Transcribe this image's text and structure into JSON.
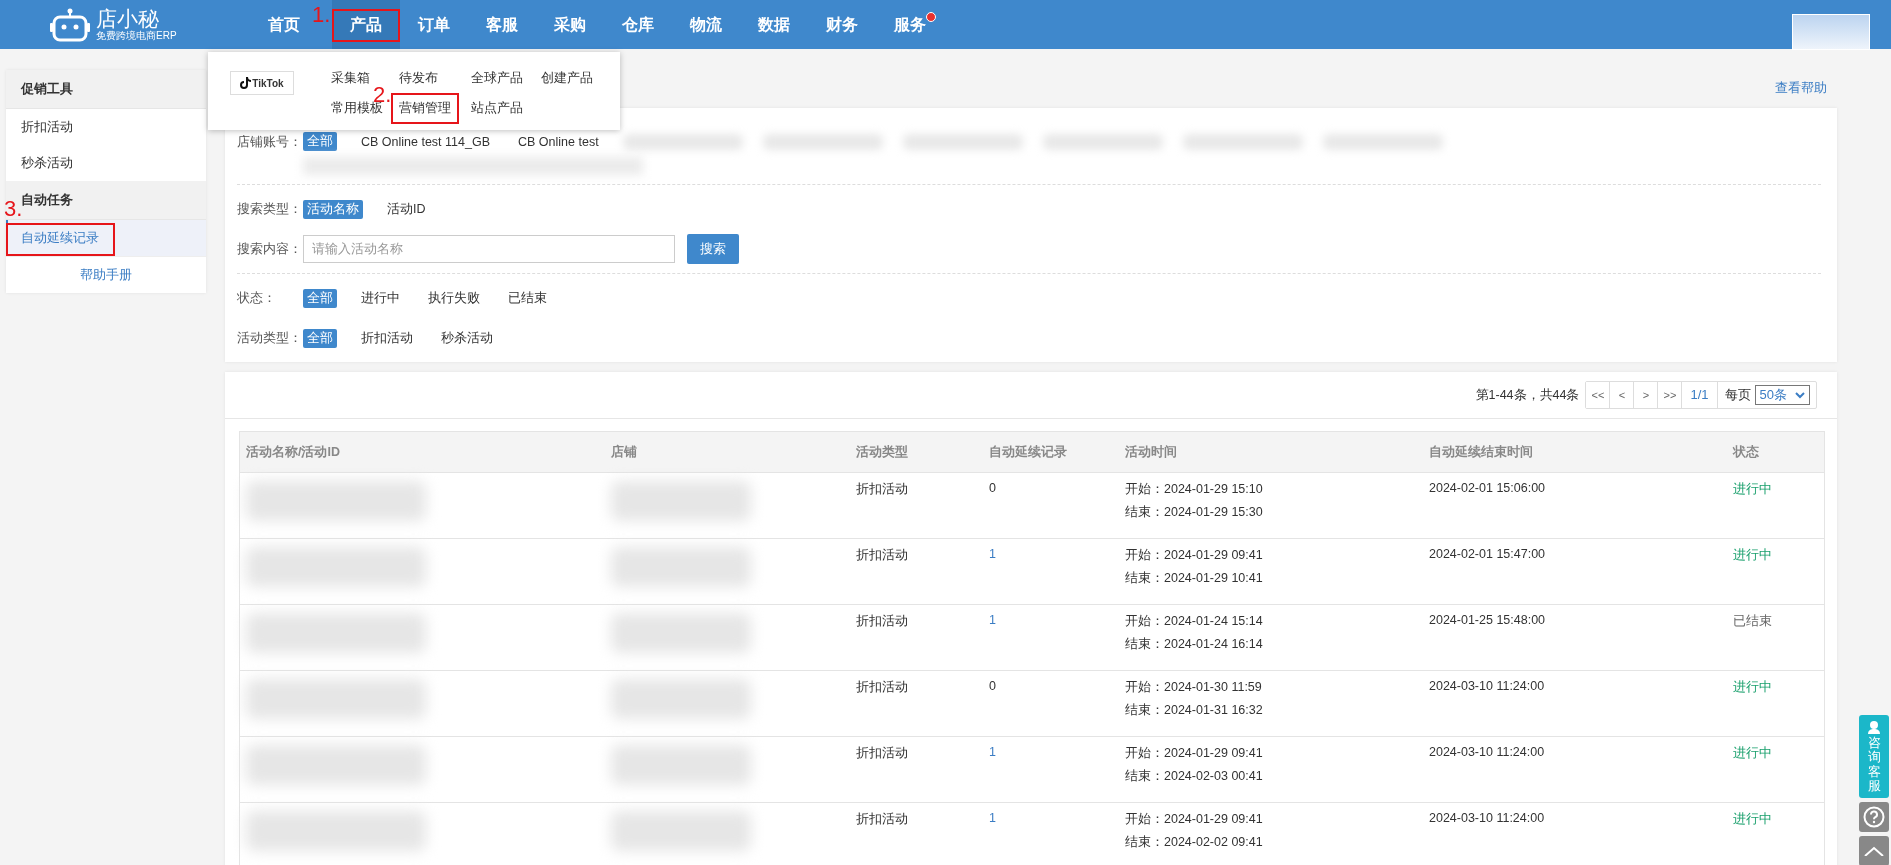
{
  "header": {
    "logo": {
      "name": "店小秘",
      "tagline": "免费跨境电商ERP"
    },
    "nav": [
      {
        "label": "首页",
        "selected": false,
        "dot": false
      },
      {
        "label": "产品",
        "selected": true,
        "dot": false,
        "annotation": "1."
      },
      {
        "label": "订单",
        "selected": false,
        "dot": false
      },
      {
        "label": "客服",
        "selected": false,
        "dot": false
      },
      {
        "label": "采购",
        "selected": false,
        "dot": false
      },
      {
        "label": "仓库",
        "selected": false,
        "dot": false
      },
      {
        "label": "物流",
        "selected": false,
        "dot": false
      },
      {
        "label": "数据",
        "selected": false,
        "dot": false
      },
      {
        "label": "财务",
        "selected": false,
        "dot": false
      },
      {
        "label": "服务",
        "selected": false,
        "dot": true
      }
    ]
  },
  "dropdown": {
    "platform": "TikTok",
    "items": [
      {
        "label": "采集箱"
      },
      {
        "label": "待发布"
      },
      {
        "label": "全球产品"
      },
      {
        "label": "创建产品"
      },
      {
        "label": "常用模板"
      },
      {
        "label": "营销管理",
        "annotation": "2."
      },
      {
        "label": "站点产品"
      }
    ]
  },
  "sidebar": {
    "groups": [
      {
        "title": "促销工具",
        "items": [
          {
            "label": "折扣活动",
            "selected": false
          },
          {
            "label": "秒杀活动",
            "selected": false
          }
        ]
      },
      {
        "title": "自动任务",
        "items": [
          {
            "label": "自动延续记录",
            "selected": true,
            "annotation": "3."
          }
        ]
      }
    ],
    "help": "帮助手册"
  },
  "help_link": "查看帮助",
  "filters": {
    "shop": {
      "label": "店铺账号：",
      "options": [
        {
          "label": "全部",
          "selected": true
        },
        {
          "label": "CB Online test 114_GB",
          "selected": false
        },
        {
          "label": "CB Online test",
          "selected": false
        }
      ]
    },
    "search_type": {
      "label": "搜索类型：",
      "options": [
        {
          "label": "活动名称",
          "selected": true
        },
        {
          "label": "活动ID",
          "selected": false
        }
      ]
    },
    "search": {
      "label": "搜索内容：",
      "placeholder": "请输入活动名称",
      "button": "搜索"
    },
    "status": {
      "label": "状态：",
      "options": [
        {
          "label": "全部",
          "selected": true
        },
        {
          "label": "进行中",
          "selected": false
        },
        {
          "label": "执行失败",
          "selected": false
        },
        {
          "label": "已结束",
          "selected": false
        }
      ]
    },
    "activity_type": {
      "label": "活动类型：",
      "options": [
        {
          "label": "全部",
          "selected": true
        },
        {
          "label": "折扣活动",
          "selected": false
        },
        {
          "label": "秒杀活动",
          "selected": false
        }
      ]
    }
  },
  "pagination": {
    "summary": "第1-44条，共44条",
    "buttons": [
      "<<",
      "<",
      ">",
      ">>"
    ],
    "page": "1/1",
    "per_page_label": "每页",
    "per_page": "50条"
  },
  "table": {
    "columns": [
      "活动名称/活动ID",
      "店铺",
      "活动类型",
      "自动延续记录",
      "活动时间",
      "自动延续结束时间",
      "状态"
    ],
    "rows": [
      {
        "type": "折扣活动",
        "records": "0",
        "linked": false,
        "start": "开始：2024-01-29 15:10",
        "end": "结束：2024-01-29 15:30",
        "renew_end": "2024-02-01 15:06:00",
        "status": "进行中",
        "running": true
      },
      {
        "type": "折扣活动",
        "records": "1",
        "linked": true,
        "start": "开始：2024-01-29 09:41",
        "end": "结束：2024-01-29 10:41",
        "renew_end": "2024-02-01 15:47:00",
        "status": "进行中",
        "running": true
      },
      {
        "type": "折扣活动",
        "records": "1",
        "linked": true,
        "start": "开始：2024-01-24 15:14",
        "end": "结束：2024-01-24 16:14",
        "renew_end": "2024-01-25 15:48:00",
        "status": "已结束",
        "running": false
      },
      {
        "type": "折扣活动",
        "records": "0",
        "linked": false,
        "start": "开始：2024-01-30 11:59",
        "end": "结束：2024-01-31 16:32",
        "renew_end": "2024-03-10 11:24:00",
        "status": "进行中",
        "running": true
      },
      {
        "type": "折扣活动",
        "records": "1",
        "linked": true,
        "start": "开始：2024-01-29 09:41",
        "end": "结束：2024-02-03 00:41",
        "renew_end": "2024-03-10 11:24:00",
        "status": "进行中",
        "running": true
      },
      {
        "type": "折扣活动",
        "records": "1",
        "linked": true,
        "start": "开始：2024-01-29 09:41",
        "end": "结束：2024-02-02 09:41",
        "renew_end": "2024-03-10 11:24:00",
        "status": "进行中",
        "running": true
      }
    ]
  },
  "float": {
    "consult": "咨询客服"
  }
}
